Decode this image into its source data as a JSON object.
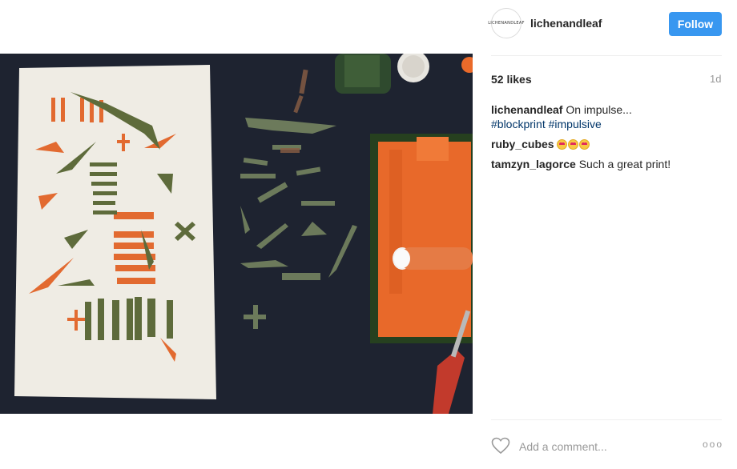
{
  "post": {
    "image_alt": "Block print artwork with orange and green shapes on fabric, cut stamps and paint roller on a dark table",
    "author": {
      "username": "lichenandleaf",
      "avatar_text": "LICHENANDLEAF"
    },
    "follow_label": "Follow",
    "likes": "52 likes",
    "age": "1d",
    "caption": {
      "username": "lichenandleaf",
      "text": "On impulse...",
      "hashtags": [
        "#blockprint",
        "#impulsive"
      ]
    },
    "comments": [
      {
        "username": "ruby_cubes",
        "emoji": "heart-eyes x3"
      },
      {
        "username": "tamzyn_lagorce",
        "text": "Such a great print!"
      }
    ],
    "add_comment_placeholder": "Add a comment...",
    "more_label": "ooo"
  },
  "colors": {
    "accent": "#3897f0",
    "hashtag": "#003569",
    "print_orange": "#e8652b",
    "print_green": "#5d6b3a",
    "table": "#1f2430"
  }
}
